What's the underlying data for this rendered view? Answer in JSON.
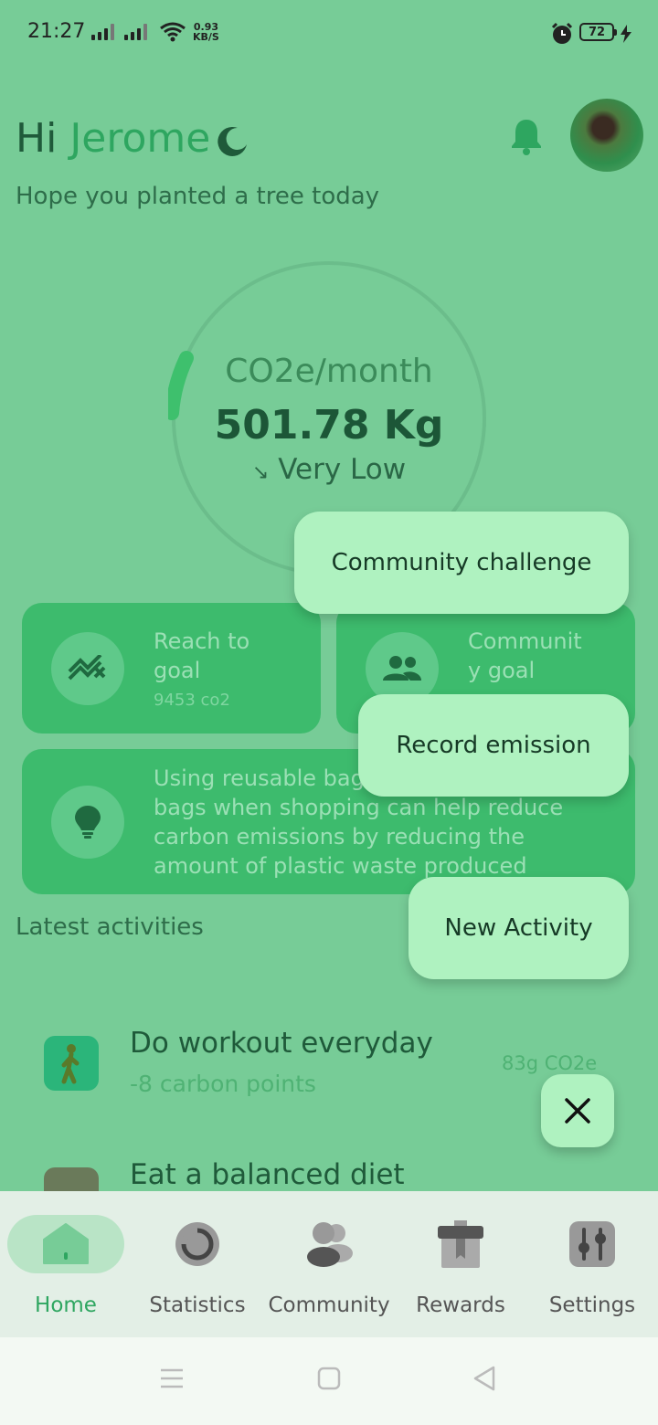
{
  "status_bar": {
    "time": "21:27",
    "net_speed_value": "0.93",
    "net_speed_unit": "KB/S",
    "battery": "72"
  },
  "header": {
    "greeting_hi": "Hi",
    "greeting_name": "Jerome",
    "subtitle": "Hope you  planted a tree today"
  },
  "gauge": {
    "caption": "CO2e/month",
    "value": "501.78 Kg",
    "status_arrow": "↘",
    "status": "Very Low",
    "progress_fraction": 0.05,
    "colors": {
      "track": "#6bbd8b",
      "progress": "#3ec06d"
    }
  },
  "cards": {
    "goal": {
      "title_line1": "Reach to",
      "title_line2": "goal",
      "sub": "9453 co2",
      "icon": "trending-icon"
    },
    "community": {
      "title_line1": "Communit",
      "title_line2": "y goal",
      "icon": "group-icon"
    },
    "tip": {
      "icon": "lightbulb-icon",
      "lines": [
        "Using reusable bag",
        "bags when shopping can help reduce",
        "carbon emissions by reducing the",
        "amount of plastic waste produced"
      ]
    }
  },
  "activities": {
    "title": "Latest activities",
    "items": [
      {
        "title": "Do workout everyday",
        "points": "-8 carbon points",
        "value": "83g CO2e",
        "icon": "walking-icon"
      },
      {
        "title": "Eat a balanced diet",
        "points": "",
        "value": "",
        "icon": "leaf-icon"
      }
    ]
  },
  "fab_menu": {
    "community_challenge": "Community challenge",
    "record_emission": "Record emission",
    "new_activity": "New Activity",
    "close_icon": "close-icon"
  },
  "bottom_nav": {
    "items": [
      {
        "label": "Home",
        "icon": "home-icon",
        "active": true
      },
      {
        "label": "Statistics",
        "icon": "statistics-icon",
        "active": false
      },
      {
        "label": "Community",
        "icon": "community-icon",
        "active": false
      },
      {
        "label": "Rewards",
        "icon": "gift-icon",
        "active": false
      },
      {
        "label": "Settings",
        "icon": "sliders-icon",
        "active": false
      }
    ]
  },
  "colors": {
    "background": "#77cc97",
    "accent": "#2ea660",
    "card": "#3dbb6d",
    "fab": "#aff2c0"
  }
}
